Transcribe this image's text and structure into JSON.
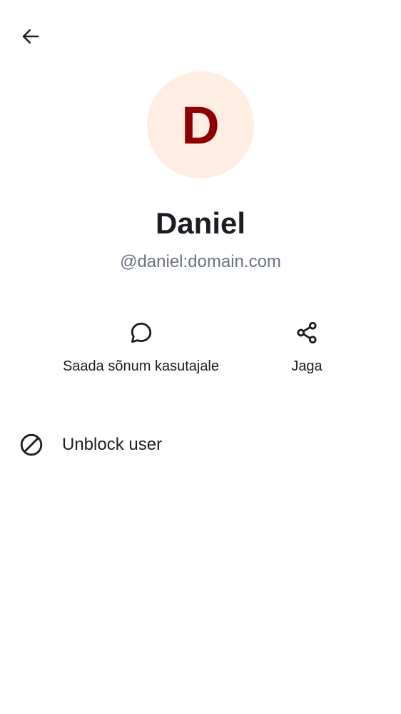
{
  "header": {
    "back_icon": "arrow-left-icon"
  },
  "profile": {
    "avatar_letter": "D",
    "avatar_bg_color": "#ffede4",
    "avatar_letter_color": "#8c0000",
    "display_name": "Daniel",
    "user_id": "@daniel:domain.com"
  },
  "actions": [
    {
      "icon": "chat-bubble-icon",
      "label": "Saada sõnum kasutajale"
    },
    {
      "icon": "share-icon",
      "label": "Jaga"
    }
  ],
  "options": [
    {
      "icon": "block-icon",
      "label": "Unblock user"
    }
  ]
}
